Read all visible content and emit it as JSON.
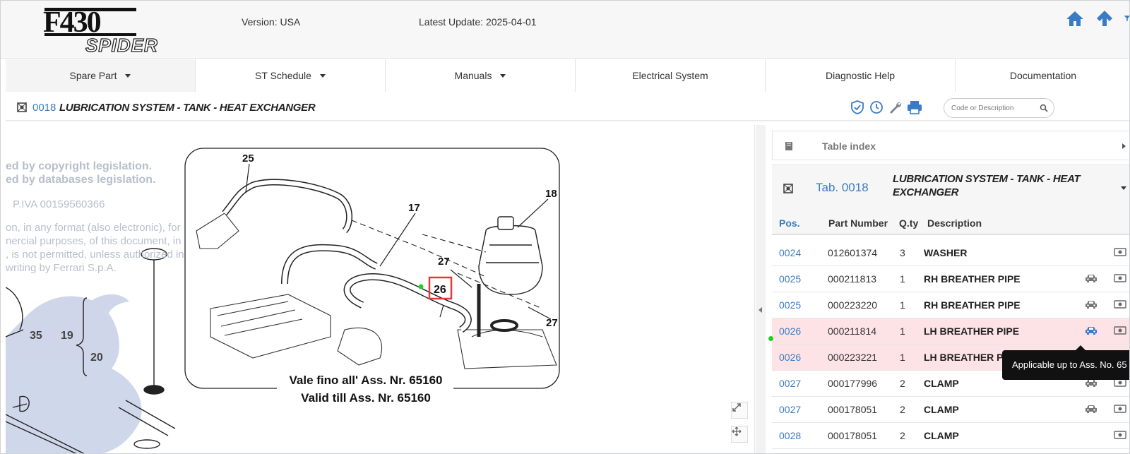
{
  "header": {
    "logo_main": "F430",
    "logo_sub": "SPIDER",
    "version": "Version: USA",
    "latest_update": "Latest Update: 2025-04-01"
  },
  "nav": [
    {
      "label": "Spare Part",
      "dropdown": true,
      "active": true
    },
    {
      "label": "ST Schedule",
      "dropdown": true
    },
    {
      "label": "Manuals",
      "dropdown": true
    },
    {
      "label": "Electrical System",
      "dropdown": false
    },
    {
      "label": "Diagnostic Help",
      "dropdown": false
    },
    {
      "label": "Documentation",
      "dropdown": false
    }
  ],
  "titlebar": {
    "code": "0018",
    "title": "LUBRICATION SYSTEM - TANK - HEAT EXCHANGER",
    "search_placeholder": "Code or Description"
  },
  "drawing": {
    "watermark_lines": [
      "ed by copyright legislation.",
      "ed by databases legislation.",
      "P.IVA 00159560366",
      "on, in any format (also electronic), for",
      "nercial purposes, of this document, in",
      ", is not permitted, unless authorized in",
      "writing by Ferrari S.p.A."
    ],
    "callouts": [
      "25",
      "17",
      "18",
      "27",
      "26",
      "27",
      "35",
      "19",
      "20"
    ],
    "caption_it": "Vale fino all' Ass. Nr. 65160",
    "caption_en": "Valid till Ass. Nr. 65160"
  },
  "panel": {
    "table_index_label": "Table index",
    "tab_code": "Tab. 0018",
    "tab_title": "LUBRICATION SYSTEM - TANK - HEAT EXCHANGER",
    "columns": {
      "pos": "Pos.",
      "part_number": "Part Number",
      "qty": "Q.ty",
      "description": "Description"
    },
    "rows": [
      {
        "pos": "0024",
        "part_number": "012601374",
        "qty": "3",
        "description": "WASHER",
        "car": false,
        "highlight": false
      },
      {
        "pos": "0025",
        "part_number": "000211813",
        "qty": "1",
        "description": "RH BREATHER PIPE",
        "car": true,
        "highlight": false
      },
      {
        "pos": "0025",
        "part_number": "000223220",
        "qty": "1",
        "description": "RH BREATHER PIPE",
        "car": true,
        "highlight": false
      },
      {
        "pos": "0026",
        "part_number": "000211814",
        "qty": "1",
        "description": "LH BREATHER PIPE",
        "car": true,
        "highlight": true
      },
      {
        "pos": "0026",
        "part_number": "000223221",
        "qty": "1",
        "description": "LH BREATHER PIPE",
        "car": true,
        "highlight": true
      },
      {
        "pos": "0027",
        "part_number": "000177996",
        "qty": "2",
        "description": "CLAMP",
        "car": true,
        "highlight": false
      },
      {
        "pos": "0027",
        "part_number": "000178051",
        "qty": "2",
        "description": "CLAMP",
        "car": true,
        "highlight": false
      },
      {
        "pos": "0028",
        "part_number": "000178051",
        "qty": "2",
        "description": "CLAMP",
        "car": false,
        "highlight": false
      }
    ],
    "tooltip": "Applicable up to Ass. No. 65"
  },
  "colors": {
    "accent": "#3a7cc4",
    "highlight_row": "#fde3e6",
    "active_icon": "#3a7cc4",
    "selection_box": "#e23b3b"
  }
}
